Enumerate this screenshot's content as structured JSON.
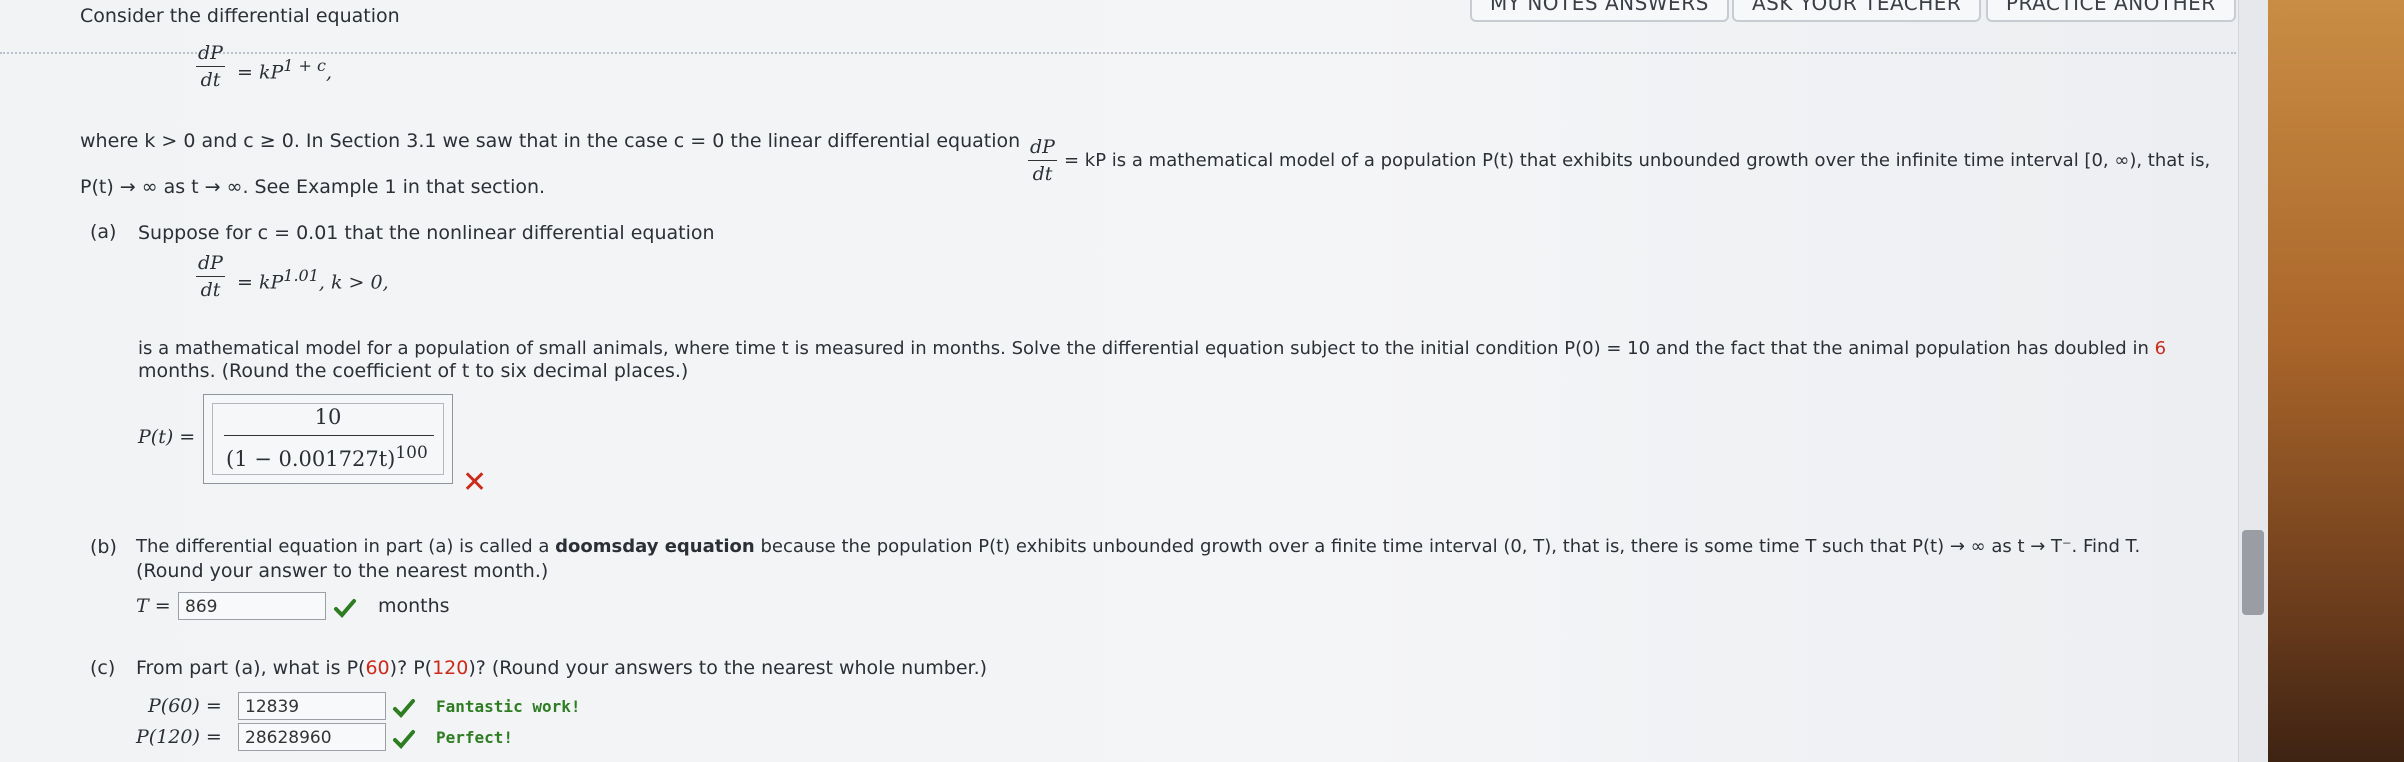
{
  "top_buttons": {
    "answers": "MY NOTES ANSWERS",
    "ask": "ASK YOUR TEACHER",
    "practice": "PRACTICE ANOTHER"
  },
  "intro": {
    "consider": "Consider the differential equation",
    "eq_num": "dP",
    "eq_den": "dt",
    "eq_rhs": "= kP",
    "eq_exp": "1 + c",
    "eq_comma": ",",
    "where_1": "where k > 0 and c ≥ 0. In Section 3.1 we saw that in the case c = 0 the linear differential equation",
    "lin_num": "dP",
    "lin_den": "dt",
    "where_2": "= kP is a mathematical model of a population P(t) that exhibits unbounded growth over the infinite time interval [0, ∞), that is,",
    "where_3": "P(t) → ∞ as t → ∞. See Example 1 in that section."
  },
  "part_a": {
    "label": "(a)",
    "text": "Suppose for c = 0.01 that the nonlinear differential equation",
    "eq_num": "dP",
    "eq_den": "dt",
    "eq_rhs": "= kP",
    "eq_exp": "1.01",
    "eq_tail": ", k > 0,",
    "desc_1": "is a mathematical model for a population of small animals, where time t is measured in months. Solve the differential equation subject to the initial condition P(0) = 10 and the fact that the animal population has doubled in",
    "desc_1_num": "6",
    "desc_2": "months. (Round the coefficient of t to six decimal places.)",
    "answer_label": "P(t) =",
    "answer_num": "10",
    "answer_den": "(1 − 0.001727t)",
    "answer_exp": "100",
    "status": "incorrect"
  },
  "part_b": {
    "label": "(b)",
    "text_1": "The differential equation in part (a) is called a",
    "bold": "doomsday equation",
    "text_2": "because the population P(t) exhibits unbounded growth over a finite time interval (0, T), that is, there is some time T such that P(t) → ∞ as t → T⁻. Find T.",
    "text_3": "(Round your answer to the nearest month.)",
    "answer_label": "T =",
    "answer_value": "869",
    "units": "months",
    "status": "correct"
  },
  "part_c": {
    "label": "(c)",
    "text_1": "From part (a), what is P(",
    "n1": "60",
    "text_2": ")? P(",
    "n2": "120",
    "text_3": ")? (Round your answers to the nearest whole number.)",
    "p60_label": "P(60) =",
    "p60_value": "12839",
    "p60_feedback": "Fantastic work!",
    "p120_label": "P(120) =",
    "p120_value": "28628960",
    "p120_feedback": "Perfect!"
  },
  "colors": {
    "incorrect": "#cc2a1a",
    "correct": "#2e7d22",
    "highlight_number": "#cc2a1a"
  }
}
